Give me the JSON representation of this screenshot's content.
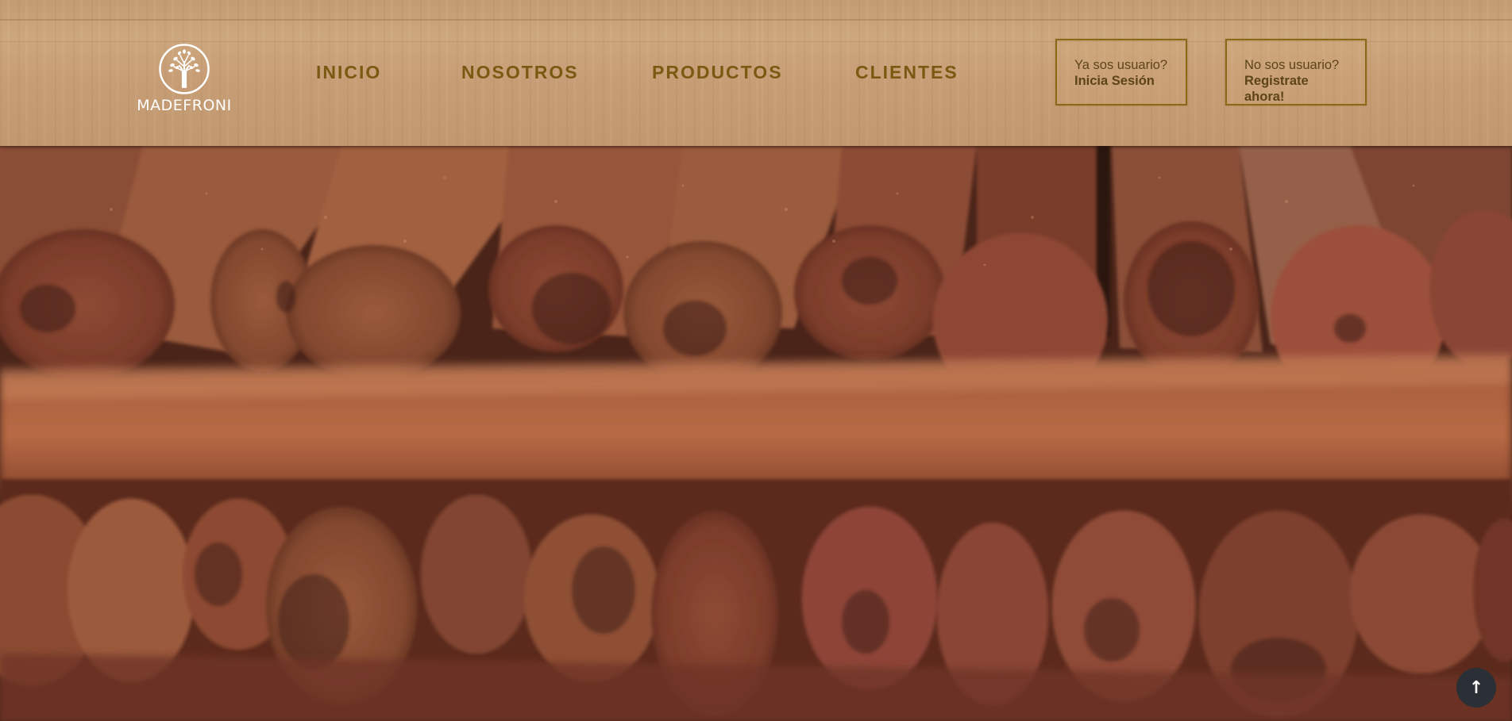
{
  "brand": {
    "name": "MADEFRONI",
    "icon": "tree-logo-icon"
  },
  "nav": {
    "items": [
      {
        "label": "INICIO"
      },
      {
        "label": "NOSOTROS"
      },
      {
        "label": "PRODUCTOS"
      },
      {
        "label": "CLIENTES"
      }
    ]
  },
  "auth": {
    "login": {
      "question": "Ya sos usuario?",
      "action": "Inicia Sesión"
    },
    "register": {
      "question": "No sos usuario?",
      "action": "Registrate ahora!"
    }
  },
  "hero": {
    "image": "wooden-logs-photo"
  },
  "scroll_top": {
    "icon": "arrow-up-icon",
    "glyph": "↑"
  },
  "colors": {
    "nav_text": "#7a5a12",
    "header_wood": "#cda27a",
    "auth_border": "#8a6818",
    "scroll_button": "#2b2f36"
  }
}
